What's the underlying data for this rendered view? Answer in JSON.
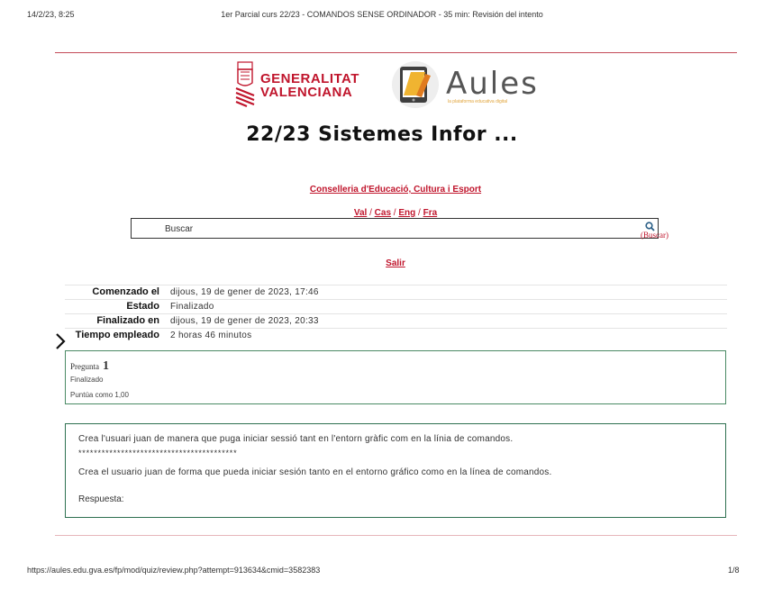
{
  "print_header": {
    "datetime": "14/2/23, 8:25",
    "page_title": "1er Parcial curs 22/23 - COMANDOS SENSE ORDINADOR - 35 min: Revisión del intento"
  },
  "brand": {
    "generalitat_line1": "GENERALITAT",
    "generalitat_line2": "VALENCIANA",
    "aules_name": "Aules",
    "aules_tagline": "la plataforma educativa digital",
    "brand_red": "#c0152c"
  },
  "course": {
    "title": "22/23 Sistemes Infor ..."
  },
  "nav": {
    "conselleria_link": "Conselleria d'Educació, Cultura i Esport",
    "languages": [
      "Val",
      "Cas",
      "Eng",
      "Fra"
    ],
    "language_separator": " / ",
    "logout_link": "Salir"
  },
  "search": {
    "value": "Buscar",
    "button_label": "(Buscar)",
    "icon": "search-icon"
  },
  "summary": [
    {
      "label": "Comenzado el",
      "value": "dijous, 19 de gener de 2023, 17:46"
    },
    {
      "label": "Estado",
      "value": "Finalizado"
    },
    {
      "label": "Finalizado en",
      "value": "dijous, 19 de gener de 2023, 20:33"
    },
    {
      "label": "Tiempo empleado",
      "value": "2 horas 46 minutos"
    }
  ],
  "question": {
    "label": "Pregunta",
    "number": "1",
    "state": "Finalizado",
    "grade": "Puntúa como 1,00",
    "text_val": "Crea l'usuari juan de manera que puga iniciar sessió tant en l'entorn gràfic com en la línia de comandos.",
    "separator": "*****************************************",
    "text_cas": "Crea el usuario juan de forma que pueda iniciar sesión tanto en el entorno gráfico como en la línea de comandos.",
    "answer_label": "Respuesta:"
  },
  "print_footer": {
    "url": "https://aules.edu.gva.es/fp/mod/quiz/review.php?attempt=913634&cmid=3582383",
    "page": "1/8"
  }
}
